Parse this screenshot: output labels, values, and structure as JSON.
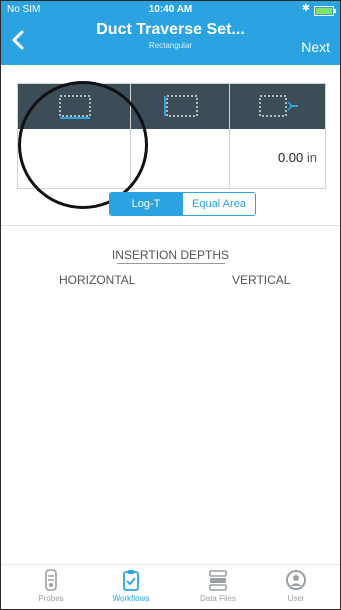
{
  "status_bar": {
    "carrier": "No SIM",
    "time": "10:40 AM",
    "bluetooth": "✱"
  },
  "nav": {
    "back_icon": "chevron-left-icon",
    "title": "Duct Traverse Set...",
    "subtitle": "Rectangular",
    "next_label": "Next"
  },
  "dimensions_table": {
    "columns": [
      {
        "icon": "width-dimension-icon",
        "value": ""
      },
      {
        "icon": "height-dimension-icon",
        "value": ""
      },
      {
        "icon": "depth-dimension-icon",
        "value": "0.00",
        "unit": "in"
      }
    ]
  },
  "method_toggle": {
    "options": [
      "Log-T",
      "Equal Area"
    ],
    "selected": "Log-T"
  },
  "insertion": {
    "title": "INSERTION DEPTHS",
    "horizontal_label": "HORIZONTAL",
    "vertical_label": "VERTICAL"
  },
  "tabs": [
    {
      "label": "Probes",
      "icon": "probe-icon"
    },
    {
      "label": "Workflows",
      "icon": "clipboard-icon",
      "active": true
    },
    {
      "label": "Data Files",
      "icon": "data-files-icon"
    },
    {
      "label": "User",
      "icon": "user-icon"
    }
  ],
  "colors": {
    "accent": "#2aa3e0",
    "table_header": "#3c4d58",
    "battery": "#7fe66a"
  }
}
